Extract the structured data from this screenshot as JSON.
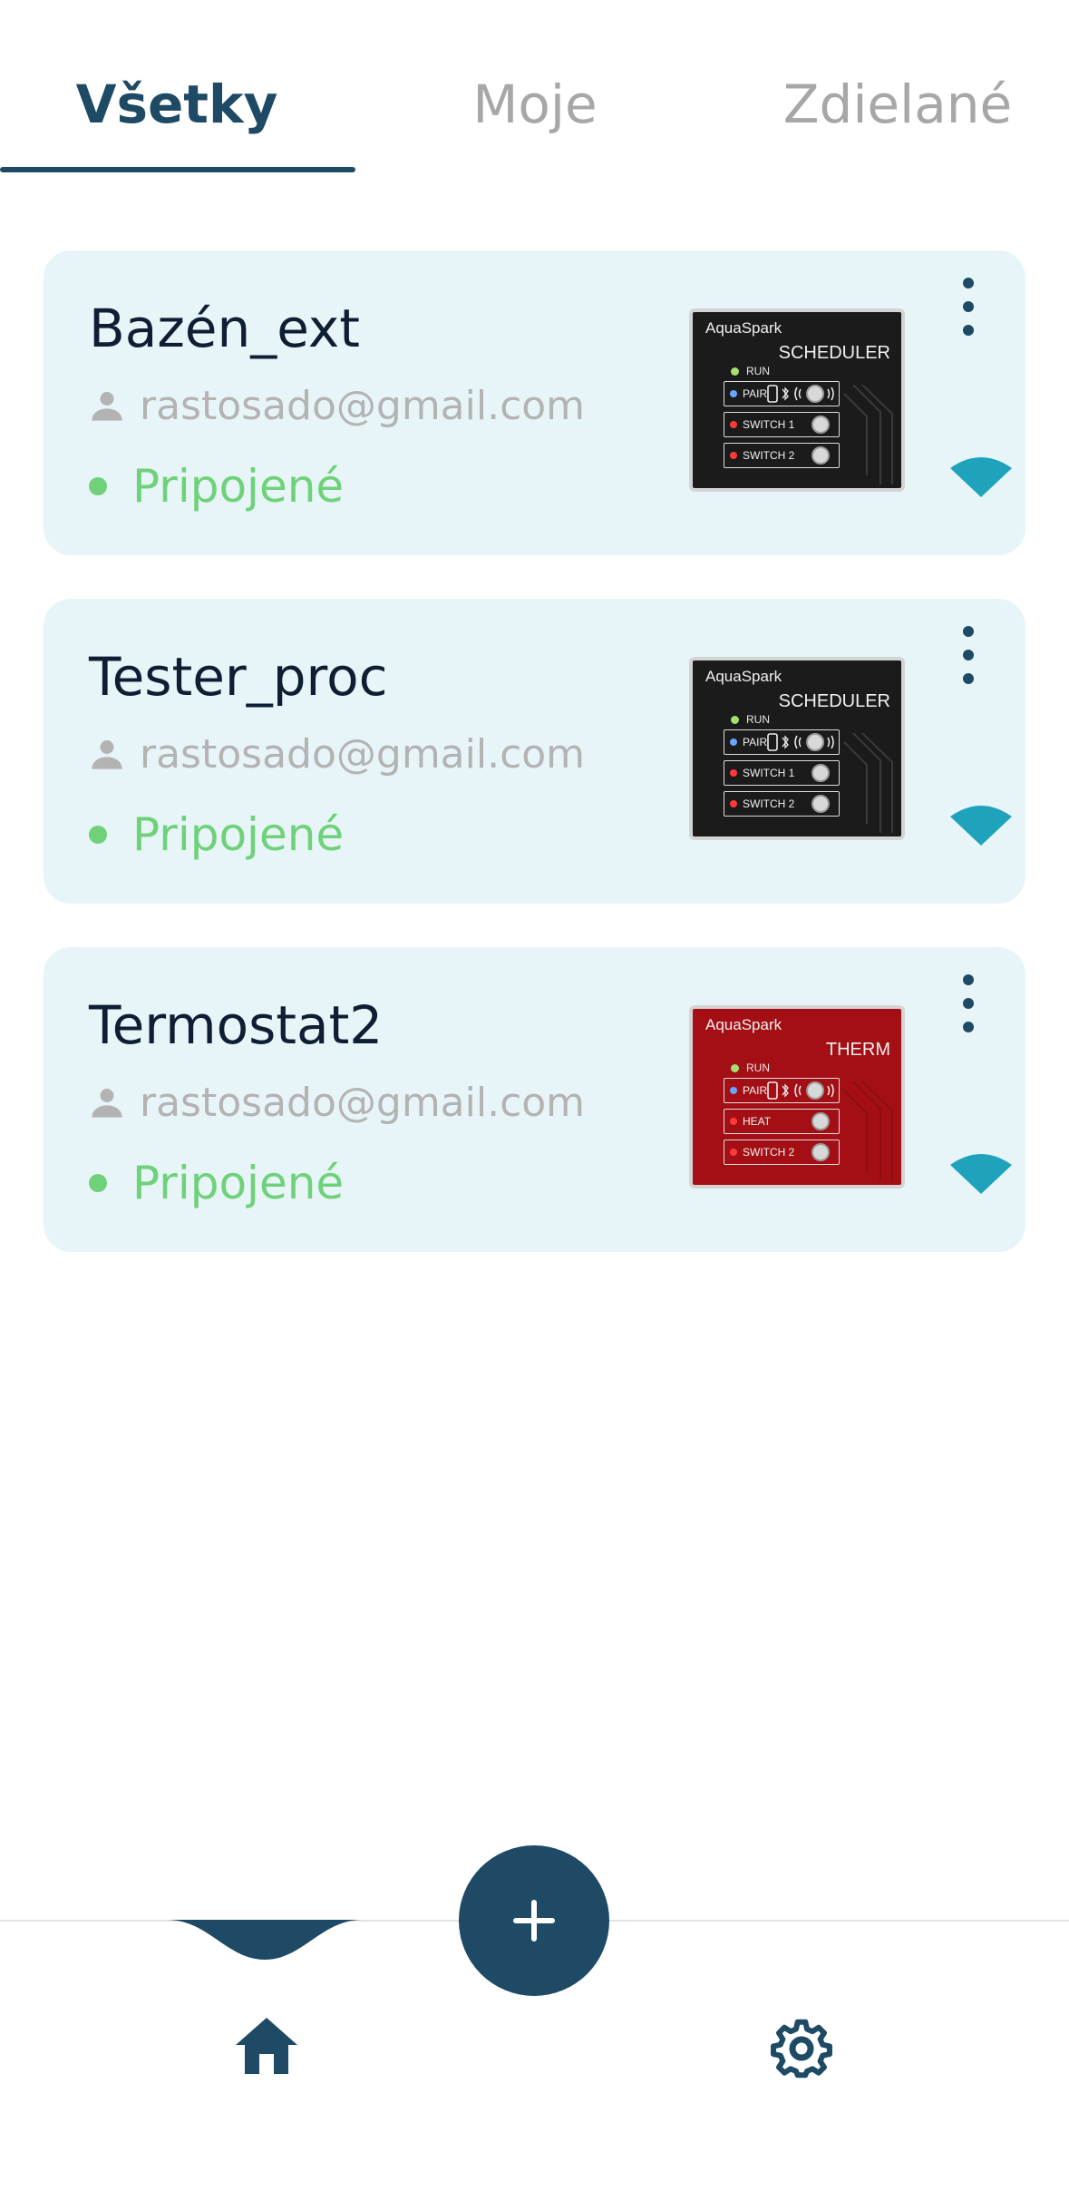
{
  "tabs": [
    {
      "label": "Všetky",
      "active": true
    },
    {
      "label": "Moje",
      "active": false
    },
    {
      "label": "Zdielané",
      "active": false
    }
  ],
  "devices": [
    {
      "name": "Bazén_ext",
      "owner": "rastosado@gmail.com",
      "status": "Pripojené",
      "image": {
        "brand": "AquaSpark",
        "model": "SCHEDULER",
        "run": "RUN",
        "rows": [
          "PAIR",
          "SWITCH 1",
          "SWITCH 2"
        ],
        "color": "#1b1b1b"
      }
    },
    {
      "name": "Tester_proc",
      "owner": "rastosado@gmail.com",
      "status": "Pripojené",
      "image": {
        "brand": "AquaSpark",
        "model": "SCHEDULER",
        "run": "RUN",
        "rows": [
          "PAIR",
          "SWITCH 1",
          "SWITCH 2"
        ],
        "color": "#1b1b1b"
      }
    },
    {
      "name": "Termostat2",
      "owner": "rastosado@gmail.com",
      "status": "Pripojené",
      "image": {
        "brand": "AquaSpark",
        "model": "THERM",
        "run": "RUN",
        "rows": [
          "PAIR",
          "HEAT",
          "SWITCH 2"
        ],
        "color": "#a30f15"
      }
    }
  ],
  "colors": {
    "primary": "#1e4a66",
    "connected": "#6fd27a",
    "wifi": "#1fa3bd",
    "card_bg": "#e8f5f8"
  },
  "icons": {
    "owner": "person-icon",
    "status": "status-dot-icon",
    "menu": "more-vertical-icon",
    "signal": "wifi-icon",
    "fab": "plus-icon",
    "nav_home": "home-icon",
    "nav_settings": "gear-icon"
  }
}
